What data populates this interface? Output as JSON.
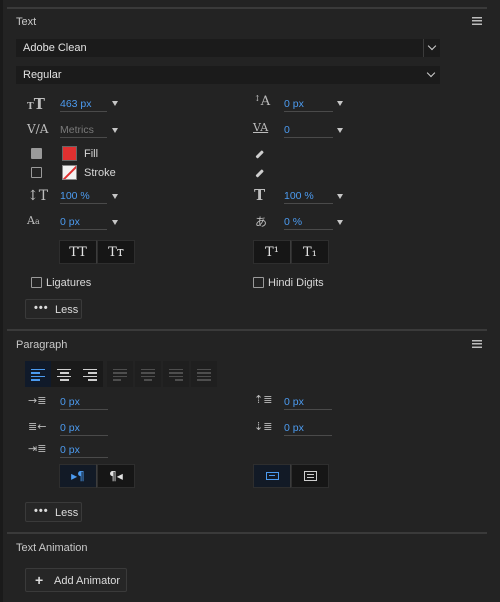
{
  "text_section": {
    "title": "Text",
    "font_family": "Adobe Clean",
    "font_style": "Regular",
    "font_size": "463 px",
    "leading": "0 px",
    "kerning": "Metrics",
    "tracking": "0",
    "fill_label": "Fill",
    "stroke_label": "Stroke",
    "fill_color": "#e03030",
    "vertical_scale": "100 %",
    "horizontal_scale": "100 %",
    "baseline_shift": "0 px",
    "tsume": "0 %",
    "btn_all_caps": "TT",
    "btn_small_caps": "Tт",
    "btn_superscript": "T¹",
    "btn_subscript": "T₁",
    "ligatures_label": "Ligatures",
    "hindi_digits_label": "Hindi Digits",
    "less_label": "Less"
  },
  "paragraph_section": {
    "title": "Paragraph",
    "indent_left": "0 px",
    "space_before": "0 px",
    "indent_right": "0 px",
    "space_after": "0 px",
    "first_line_indent": "0 px",
    "less_label": "Less"
  },
  "animation_section": {
    "title": "Text Animation",
    "add_animator_label": "Add Animator"
  },
  "colors": {
    "accent_blue": "#4c9bf0",
    "fill_red": "#e03030"
  }
}
